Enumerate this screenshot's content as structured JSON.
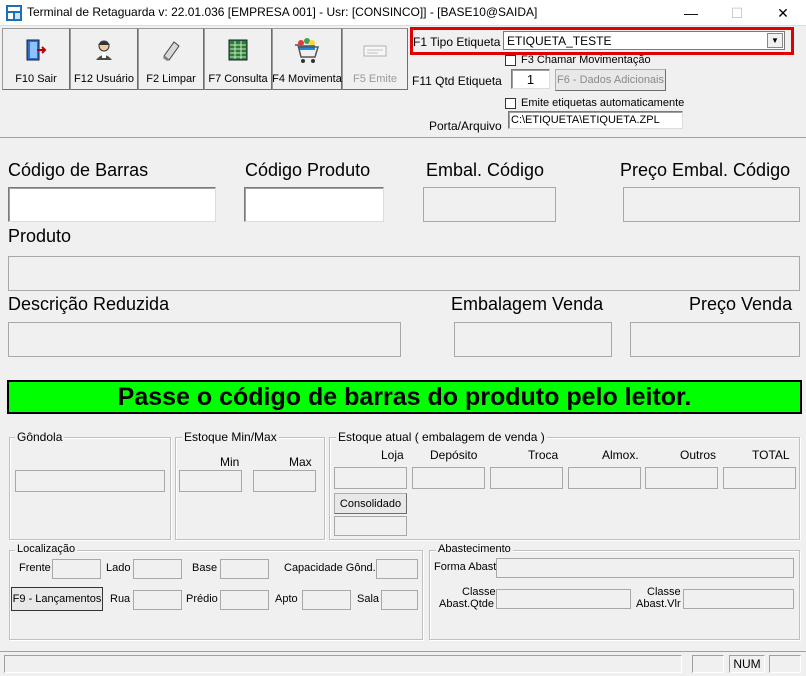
{
  "window": {
    "title": "Terminal de Retaguarda v: 22.01.036 [EMPRESA 001] - Usr: [CONSINCO]] - [BASE10@SAIDA]",
    "minimize": "—",
    "maximize": "☐",
    "close": "✕"
  },
  "toolbar": {
    "sair": "F10 Sair",
    "usuario": "F12 Usuário",
    "limpar": "F2 Limpar",
    "consulta": "F7 Consulta",
    "movimenta": "F4 Movimenta",
    "emite": "F5 Emite"
  },
  "etiqueta": {
    "tipo_label": "F1 Tipo Etiqueta",
    "tipo_value": "ETIQUETA_TESTE",
    "chamar_label": "F3 Chamar Movimentação",
    "qtd_label": "F11 Qtd Etiqueta",
    "qtd_value": "1",
    "dados_adicionais": "F6 - Dados Adicionais",
    "emite_auto_label": "Emite etiquetas automaticamente",
    "porta_label": "Porta/Arquivo",
    "porta_value": "C:\\ETIQUETA\\ETIQUETA.ZPL"
  },
  "produto": {
    "codigo_barras": "Código de Barras",
    "codigo_produto": "Código Produto",
    "embal_codigo": "Embal. Código",
    "preco_embal_codigo": "Preço Embal. Código",
    "produto": "Produto",
    "descricao_reduzida": "Descrição Reduzida",
    "embalagem_venda": "Embalagem Venda",
    "preco_venda": "Preço Venda"
  },
  "banner": "Passe o código de barras do produto pelo leitor.",
  "gondola": {
    "title": "Gôndola"
  },
  "estoque_minmax": {
    "title": "Estoque Min/Max",
    "min": "Min",
    "max": "Max"
  },
  "estoque_atual": {
    "title": "Estoque atual ( embalagem de venda )",
    "loja": "Loja",
    "deposito": "Depósito",
    "troca": "Troca",
    "almox": "Almox.",
    "outros": "Outros",
    "total": "TOTAL",
    "consolidado": "Consolidado"
  },
  "localizacao": {
    "title": "Localização",
    "frente": "Frente",
    "lado": "Lado",
    "base": "Base",
    "capacidade": "Capacidade Gônd.",
    "lancamentos": "F9 - Lançamentos",
    "rua": "Rua",
    "predio": "Prédio",
    "apto": "Apto",
    "sala": "Sala"
  },
  "abastecimento": {
    "title": "Abastecimento",
    "forma": "Forma Abast",
    "classe_qtde_1": "Classe",
    "classe_qtde_2": "Abast.Qtde",
    "classe_vlr_1": "Classe",
    "classe_vlr_2": "Abast.Vlr"
  },
  "statusbar": {
    "num": "NUM"
  },
  "colors": {
    "banner": "#00ff00",
    "highlight": "#e00000"
  }
}
